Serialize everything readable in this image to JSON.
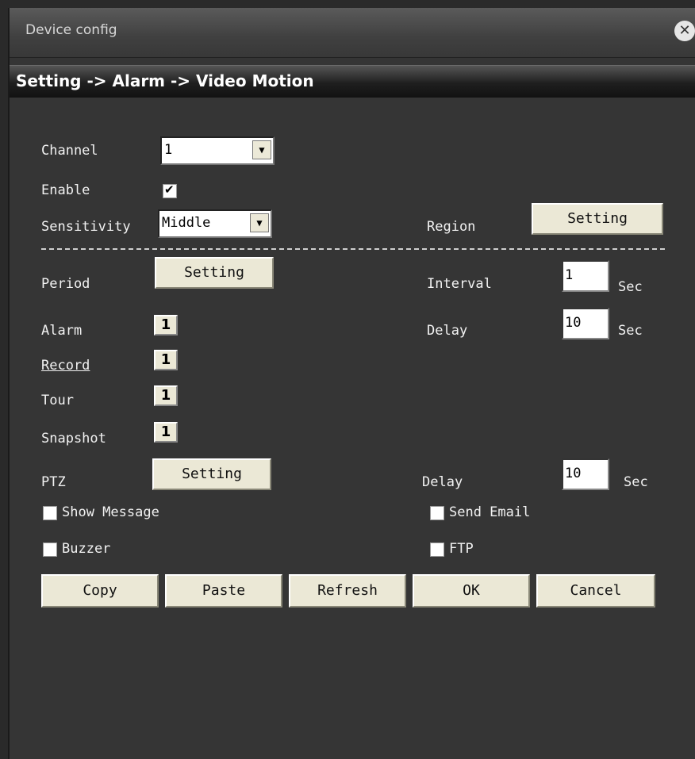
{
  "window": {
    "title": "Device config"
  },
  "breadcrumb": "Setting -> Alarm -> Video Motion",
  "fields": {
    "channel_label": "Channel",
    "channel_value": "1",
    "enable_label": "Enable",
    "enable_checked": true,
    "sensitivity_label": "Sensitivity",
    "sensitivity_value": "Middle",
    "region_label": "Region",
    "region_button": "Setting",
    "period_label": "Period",
    "period_button": "Setting",
    "interval_label": "Interval",
    "interval_value": "1",
    "interval_unit": "Sec",
    "alarm_label": "Alarm",
    "alarm_value": "1",
    "delay_label": "Delay",
    "delay_value": "10",
    "delay_unit": "Sec",
    "record_label": "Record",
    "record_value": "1",
    "tour_label": "Tour",
    "tour_value": "1",
    "snapshot_label": "Snapshot",
    "snapshot_value": "1",
    "ptz_label": "PTZ",
    "ptz_button": "Setting",
    "ptz_delay_label": "Delay",
    "ptz_delay_value": "10",
    "ptz_delay_unit": "Sec"
  },
  "options": {
    "show_message": {
      "label": "Show Message",
      "checked": false
    },
    "send_email": {
      "label": "Send Email",
      "checked": false
    },
    "buzzer": {
      "label": "Buzzer",
      "checked": false
    },
    "ftp": {
      "label": "FTP",
      "checked": false
    }
  },
  "buttons": {
    "copy": "Copy",
    "paste": "Paste",
    "refresh": "Refresh",
    "ok": "OK",
    "cancel": "Cancel"
  },
  "icons": {
    "close": "close-icon",
    "dropdown": "chevron-down-icon",
    "check": "checkmark-icon"
  }
}
